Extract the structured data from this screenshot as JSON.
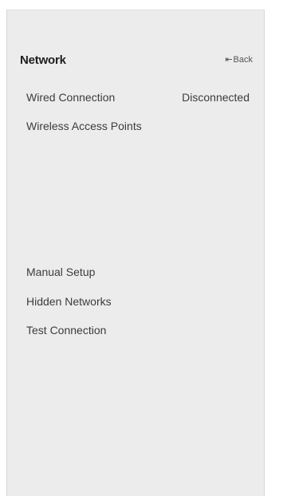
{
  "header": {
    "title": "Network",
    "back_icon": "back-arrow-icon",
    "back_label": "Back"
  },
  "menu": {
    "wired": {
      "label": "Wired Connection",
      "value": "Disconnected"
    },
    "wireless": {
      "label": "Wireless Access Points"
    },
    "manual": {
      "label": "Manual Setup"
    },
    "hidden": {
      "label": "Hidden Networks"
    },
    "test": {
      "label": "Test Connection"
    }
  },
  "colors": {
    "panel_background": "#ececec",
    "text": "#3c3c3c",
    "title": "#1e1e1e"
  }
}
